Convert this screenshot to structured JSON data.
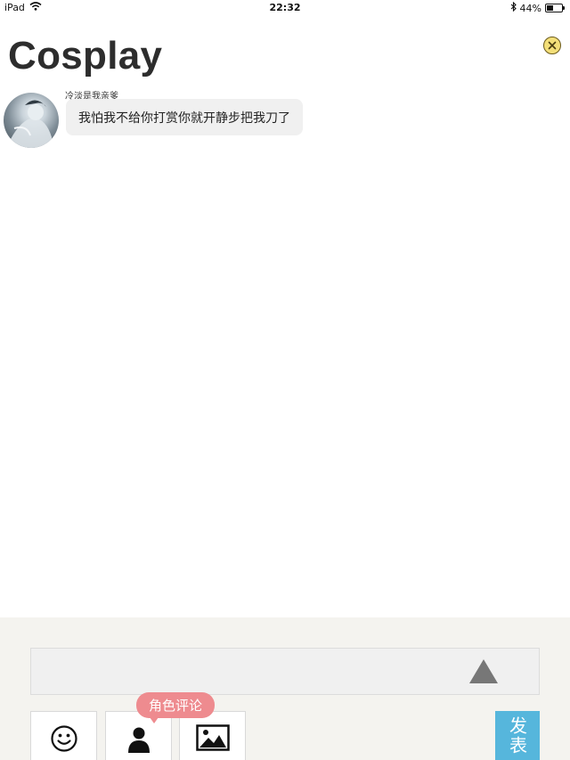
{
  "status_bar": {
    "device": "iPad",
    "time": "22:32",
    "battery_text": "44%",
    "battery_level": 0.44
  },
  "page": {
    "title": "Cosplay"
  },
  "messages": [
    {
      "sender": "冷淡是我亲爹",
      "text": "我怕我不给你打赏你就开静步把我刀了"
    }
  ],
  "composer": {
    "input_value": "",
    "tooltip": "角色评论",
    "send_label": "发表"
  },
  "colors": {
    "composer_bg": "#f4f3ef",
    "tooltip_bg": "#ee8b8f",
    "send_bg": "#56b6dc",
    "close_bg": "#f3df79"
  },
  "icons": {
    "close": "close-icon",
    "emoji": "smiley-icon",
    "role": "person-icon",
    "image": "image-icon",
    "send_arrow": "triangle-up-icon"
  }
}
